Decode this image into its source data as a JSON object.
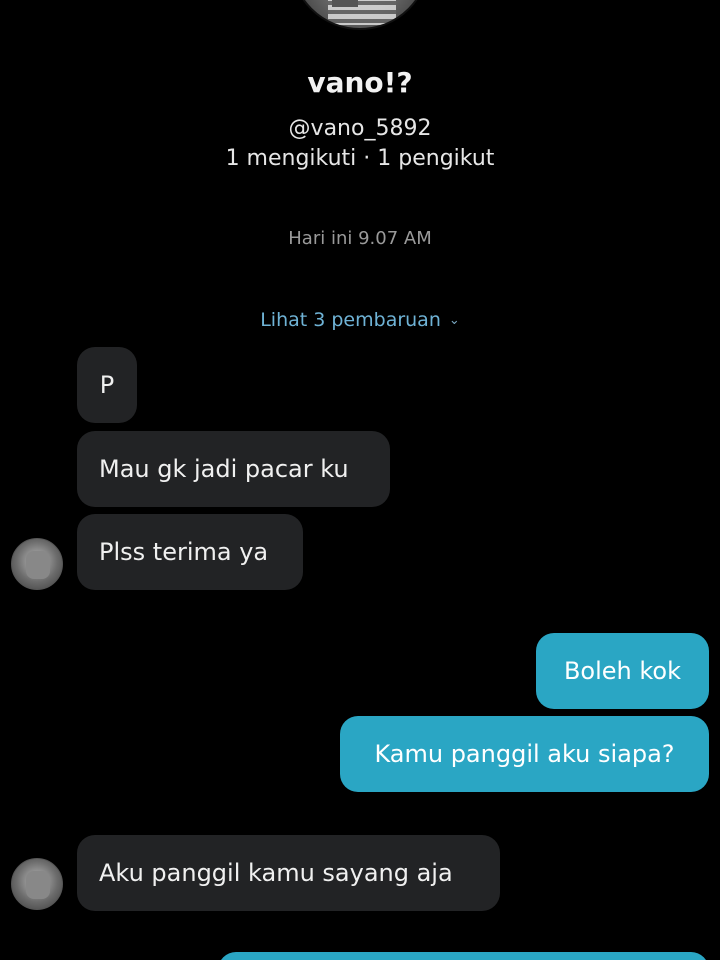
{
  "profile": {
    "name": "vano!?",
    "handle": "@vano_5892",
    "stats": "1 mengikuti · 1 pengikut"
  },
  "chat": {
    "timestamp": "Hari ini 9.07 AM",
    "updates_link": "Lihat 3 pembaruan",
    "updates_icon": "chevron-down-icon",
    "messages": [
      {
        "sender": "them",
        "text": "P"
      },
      {
        "sender": "them",
        "text": "Mau gk jadi pacar ku"
      },
      {
        "sender": "them",
        "text": "Plss terima ya"
      },
      {
        "sender": "me",
        "text": "Boleh kok"
      },
      {
        "sender": "me",
        "text": "Kamu panggil aku siapa?"
      },
      {
        "sender": "them",
        "text": "Aku panggil kamu sayang aja"
      }
    ]
  },
  "colors": {
    "background": "#000000",
    "incoming_bubble": "#222325",
    "outgoing_bubble": "#2aa6c4",
    "link": "#6fb3d6"
  }
}
